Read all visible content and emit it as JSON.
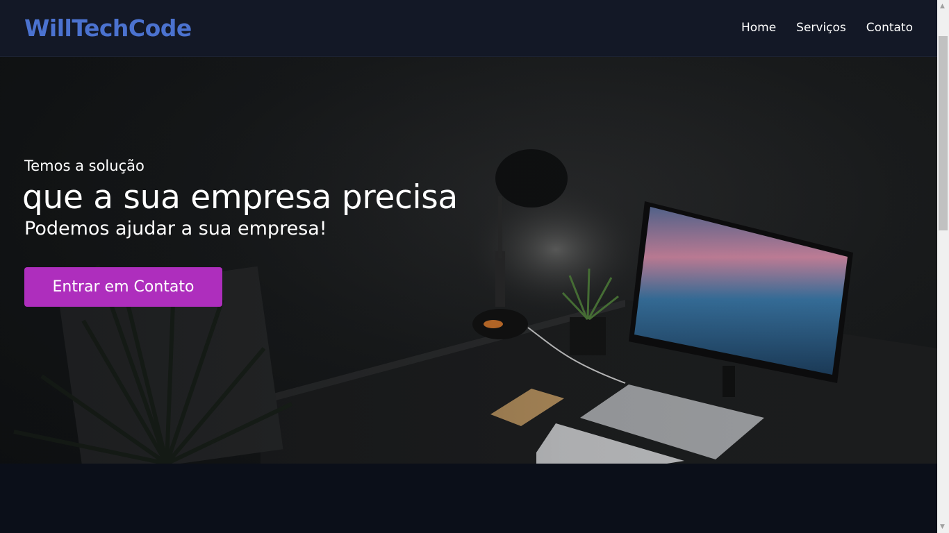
{
  "header": {
    "logo": "WillTechCode",
    "nav": [
      {
        "label": "Home"
      },
      {
        "label": "Serviços"
      },
      {
        "label": "Contato"
      }
    ]
  },
  "hero": {
    "kicker": "Temos a solução",
    "headline": "que a sua empresa precisa",
    "subline": "Podemos ajudar a sua empresa!",
    "cta_label": "Entrar em Contato"
  },
  "colors": {
    "logo": "#4b72cf",
    "cta": "#ae2ebd",
    "header_bg": "#131826",
    "page_bg": "#0b0f19"
  },
  "scrollbar": {
    "up_icon": "chevron-up-icon",
    "down_icon": "chevron-down-icon"
  }
}
